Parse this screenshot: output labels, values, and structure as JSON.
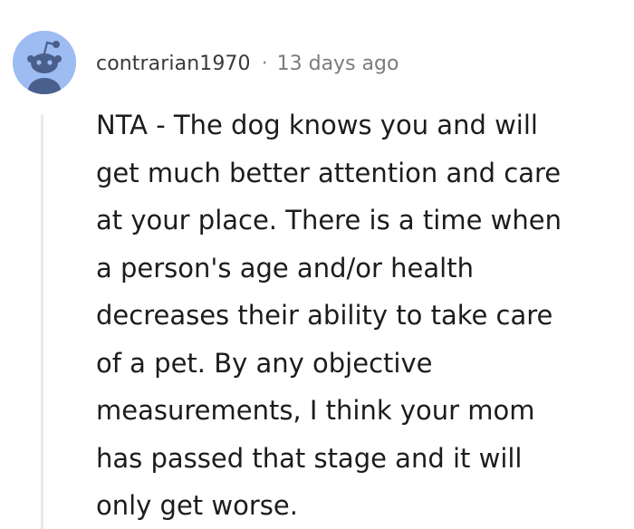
{
  "comment": {
    "author": "contrarian1970",
    "separator": "·",
    "timestamp": "13 days ago",
    "avatar_icon": "reddit-snoo-avatar-icon",
    "body_lines": [
      "NTA - The dog knows you and will",
      "get much better attention and care",
      "at your place. There is a time when",
      "a person's age and/or health",
      "decreases their ability to take care",
      "of a pet. By any objective",
      "measurements, I think your mom",
      "has passed that stage and it will",
      "only get worse."
    ]
  },
  "colors": {
    "avatar_background": "#9dbcf2",
    "avatar_figure": "#4a5f8c",
    "thread_line": "#e9e9e9",
    "text": "#1c1c1c",
    "meta": "#7c7c7c"
  }
}
